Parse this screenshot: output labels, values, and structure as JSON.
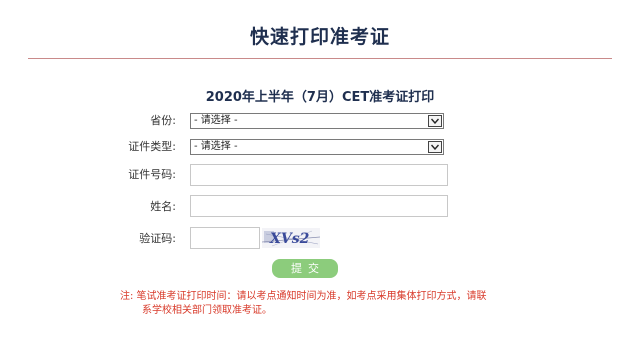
{
  "page_title": "快速打印准考证",
  "form_title": "2020年上半年（7月）CET准考证打印",
  "fields": {
    "province": {
      "label": "省份:",
      "value": "- 请选择 -"
    },
    "id_type": {
      "label": "证件类型:",
      "value": "- 请选择 -"
    },
    "id_number": {
      "label": "证件号码:",
      "value": ""
    },
    "name": {
      "label": "姓名:",
      "value": ""
    },
    "captcha": {
      "label": "验证码:",
      "value": "",
      "image_text": "XVs2"
    }
  },
  "submit_label": "提交",
  "note": {
    "line1": "注:  笔试准考证打印时间：请以考点通知时间为准，如考点采用集体打印方式，请联",
    "line2": "系学校相关部门领取准考证。"
  },
  "colors": {
    "title": "#1f2f4f",
    "rule": "#c98a8a",
    "submit_bg": "#8ccc7c",
    "note": "#d83a2a"
  }
}
